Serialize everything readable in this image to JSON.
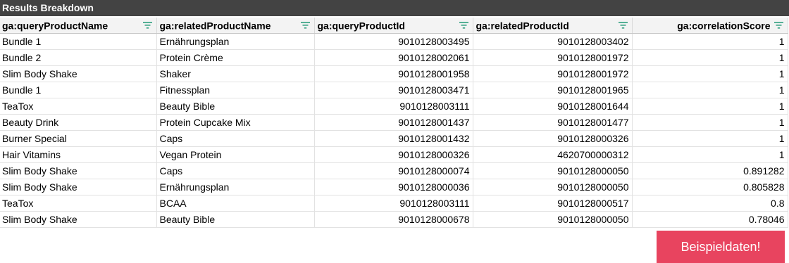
{
  "panel": {
    "title": "Results Breakdown"
  },
  "table": {
    "columns": [
      {
        "label": "ga:queryProductName",
        "align": "left",
        "icon": "filter-icon"
      },
      {
        "label": "ga:relatedProductName",
        "align": "left",
        "icon": "filter-icon"
      },
      {
        "label": "ga:queryProductId",
        "align": "right",
        "icon": "filter-icon"
      },
      {
        "label": "ga:relatedProductId",
        "align": "right",
        "icon": "filter-icon"
      },
      {
        "label": "ga:correlationScore",
        "align": "right",
        "icon": "filter-icon"
      }
    ],
    "rows": [
      [
        "Bundle 1",
        "Ernährungsplan",
        "9010128003495",
        "9010128003402",
        "1"
      ],
      [
        "Bundle 2",
        "Protein Crème",
        "9010128002061",
        "9010128001972",
        "1"
      ],
      [
        "Slim Body Shake",
        "Shaker",
        "9010128001958",
        "9010128001972",
        "1"
      ],
      [
        "Bundle 1",
        "Fitnessplan",
        "9010128003471",
        "9010128001965",
        "1"
      ],
      [
        "TeaTox",
        "Beauty Bible",
        "9010128003111",
        "9010128001644",
        "1"
      ],
      [
        "Beauty Drink",
        "Protein Cupcake Mix",
        "9010128001437",
        "9010128001477",
        "1"
      ],
      [
        "Burner Special",
        "Caps",
        "9010128001432",
        "9010128000326",
        "1"
      ],
      [
        "Hair Vitamins",
        "Vegan Protein",
        "9010128000326",
        "4620700000312",
        "1"
      ],
      [
        "Slim Body Shake",
        "Caps",
        "9010128000074",
        "9010128000050",
        "0.891282"
      ],
      [
        "Slim Body Shake",
        "Ernährungsplan",
        "9010128000036",
        "9010128000050",
        "0.805828"
      ],
      [
        "TeaTox",
        "BCAA",
        "9010128003111",
        "9010128000517",
        "0.8"
      ],
      [
        "Slim Body Shake",
        "Beauty Bible",
        "9010128000678",
        "9010128000050",
        "0.78046"
      ]
    ]
  },
  "cta": {
    "label": "Beispieldaten!",
    "color": "#e8445f"
  },
  "colors": {
    "title_bar": "#434343",
    "filter_icon": "#2e9f7e"
  }
}
